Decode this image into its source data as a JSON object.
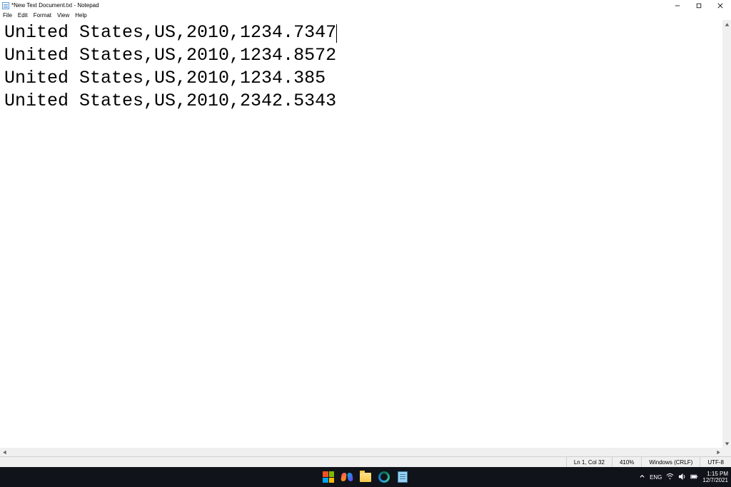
{
  "titlebar": {
    "title": "*New Text Document.txt - Notepad"
  },
  "menu": {
    "file": "File",
    "edit": "Edit",
    "format": "Format",
    "view": "View",
    "help": "Help"
  },
  "content": {
    "lines": [
      "United States,US,2010,1234.7347",
      "United States,US,2010,1234.8572",
      "United States,US,2010,1234.385",
      "United States,US,2010,2342.5343"
    ]
  },
  "statusbar": {
    "position": "Ln 1, Col 32",
    "zoom": "410%",
    "line_ending": "Windows (CRLF)",
    "encoding": "UTF-8"
  },
  "systray": {
    "lang": "ENG",
    "time": "1:15 PM",
    "date": "12/7/2021"
  }
}
